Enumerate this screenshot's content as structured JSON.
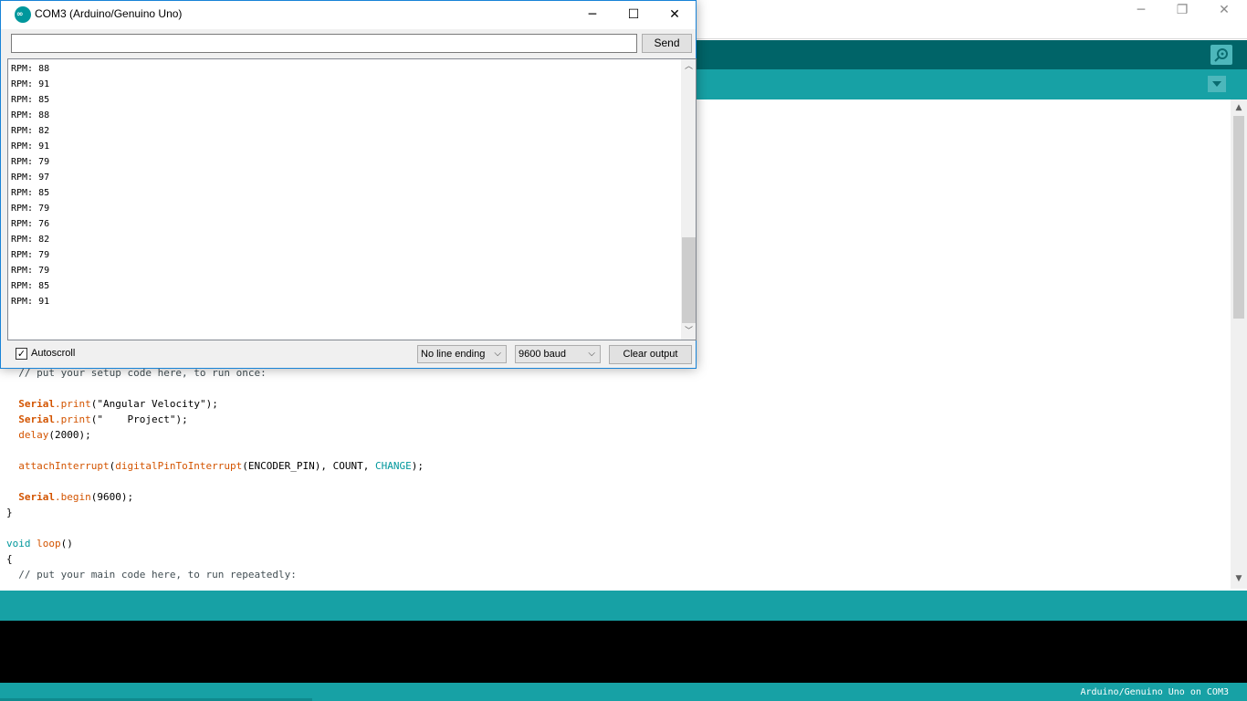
{
  "ide": {
    "window_controls": {
      "minimize": "─",
      "restore": "❐",
      "close": "✕"
    },
    "editor": {
      "lines": [
        {
          "text": "// put your setup code here, to run once:",
          "indent": "  "
        },
        {
          "text": "",
          "indent": ""
        },
        {
          "obj": "Serial",
          "method": "print",
          "rest": "(\"Angular Velocity\");",
          "indent": "  "
        },
        {
          "obj": "Serial",
          "method": "print",
          "rest": "(\"    Project\");",
          "indent": "  "
        },
        {
          "fn": "delay",
          "rest": "(2000);",
          "indent": "  "
        },
        {
          "text": "",
          "indent": ""
        },
        {
          "fn": "attachInterrupt",
          "rest1": "(",
          "fn2": "digitalPinToInterrupt",
          "rest2": "(ENCODER_PIN), COUNT, ",
          "const": "CHANGE",
          "rest3": ");",
          "indent": "  "
        },
        {
          "text": "",
          "indent": ""
        },
        {
          "obj": "Serial",
          "method": "begin",
          "rest": "(9600);",
          "indent": "  "
        },
        {
          "text": "}",
          "indent": ""
        },
        {
          "text": "",
          "indent": ""
        },
        {
          "type": "void",
          "fn": "loop",
          "rest": "()",
          "indent": ""
        },
        {
          "text": "{",
          "indent": ""
        },
        {
          "text": "// put your main code here, to run repeatedly:",
          "indent": "  "
        }
      ]
    },
    "footer": {
      "board": "Arduino/Genuino Uno on COM3"
    }
  },
  "serial_monitor": {
    "title": "COM3 (Arduino/Genuino Uno)",
    "window_controls": {
      "minimize": "─",
      "maximize": "☐",
      "close": "✕"
    },
    "input": {
      "value": "",
      "placeholder": ""
    },
    "send_label": "Send",
    "output_lines": [
      "RPM: 88",
      "RPM: 91",
      "RPM: 85",
      "RPM: 88",
      "RPM: 82",
      "RPM: 91",
      "RPM: 79",
      "RPM: 97",
      "RPM: 85",
      "RPM: 79",
      "RPM: 76",
      "RPM: 82",
      "RPM: 79",
      "RPM: 79",
      "RPM: 85",
      "RPM: 91"
    ],
    "autoscroll": {
      "label": "Autoscroll",
      "checked": true
    },
    "line_ending": "No line ending",
    "baud": "9600 baud",
    "clear_label": "Clear output"
  },
  "colors": {
    "toolbar": "#006468",
    "tabbar": "#17a1a5",
    "keyword_orange": "#d35400",
    "keyword_teal": "#00979c",
    "accent_border": "#1883d7"
  },
  "icons": [
    "arduino-logo-icon",
    "serial-monitor-icon",
    "tab-menu-icon",
    "checkbox-check-icon",
    "chevron-down-icon",
    "scroll-up-icon",
    "scroll-down-icon"
  ]
}
